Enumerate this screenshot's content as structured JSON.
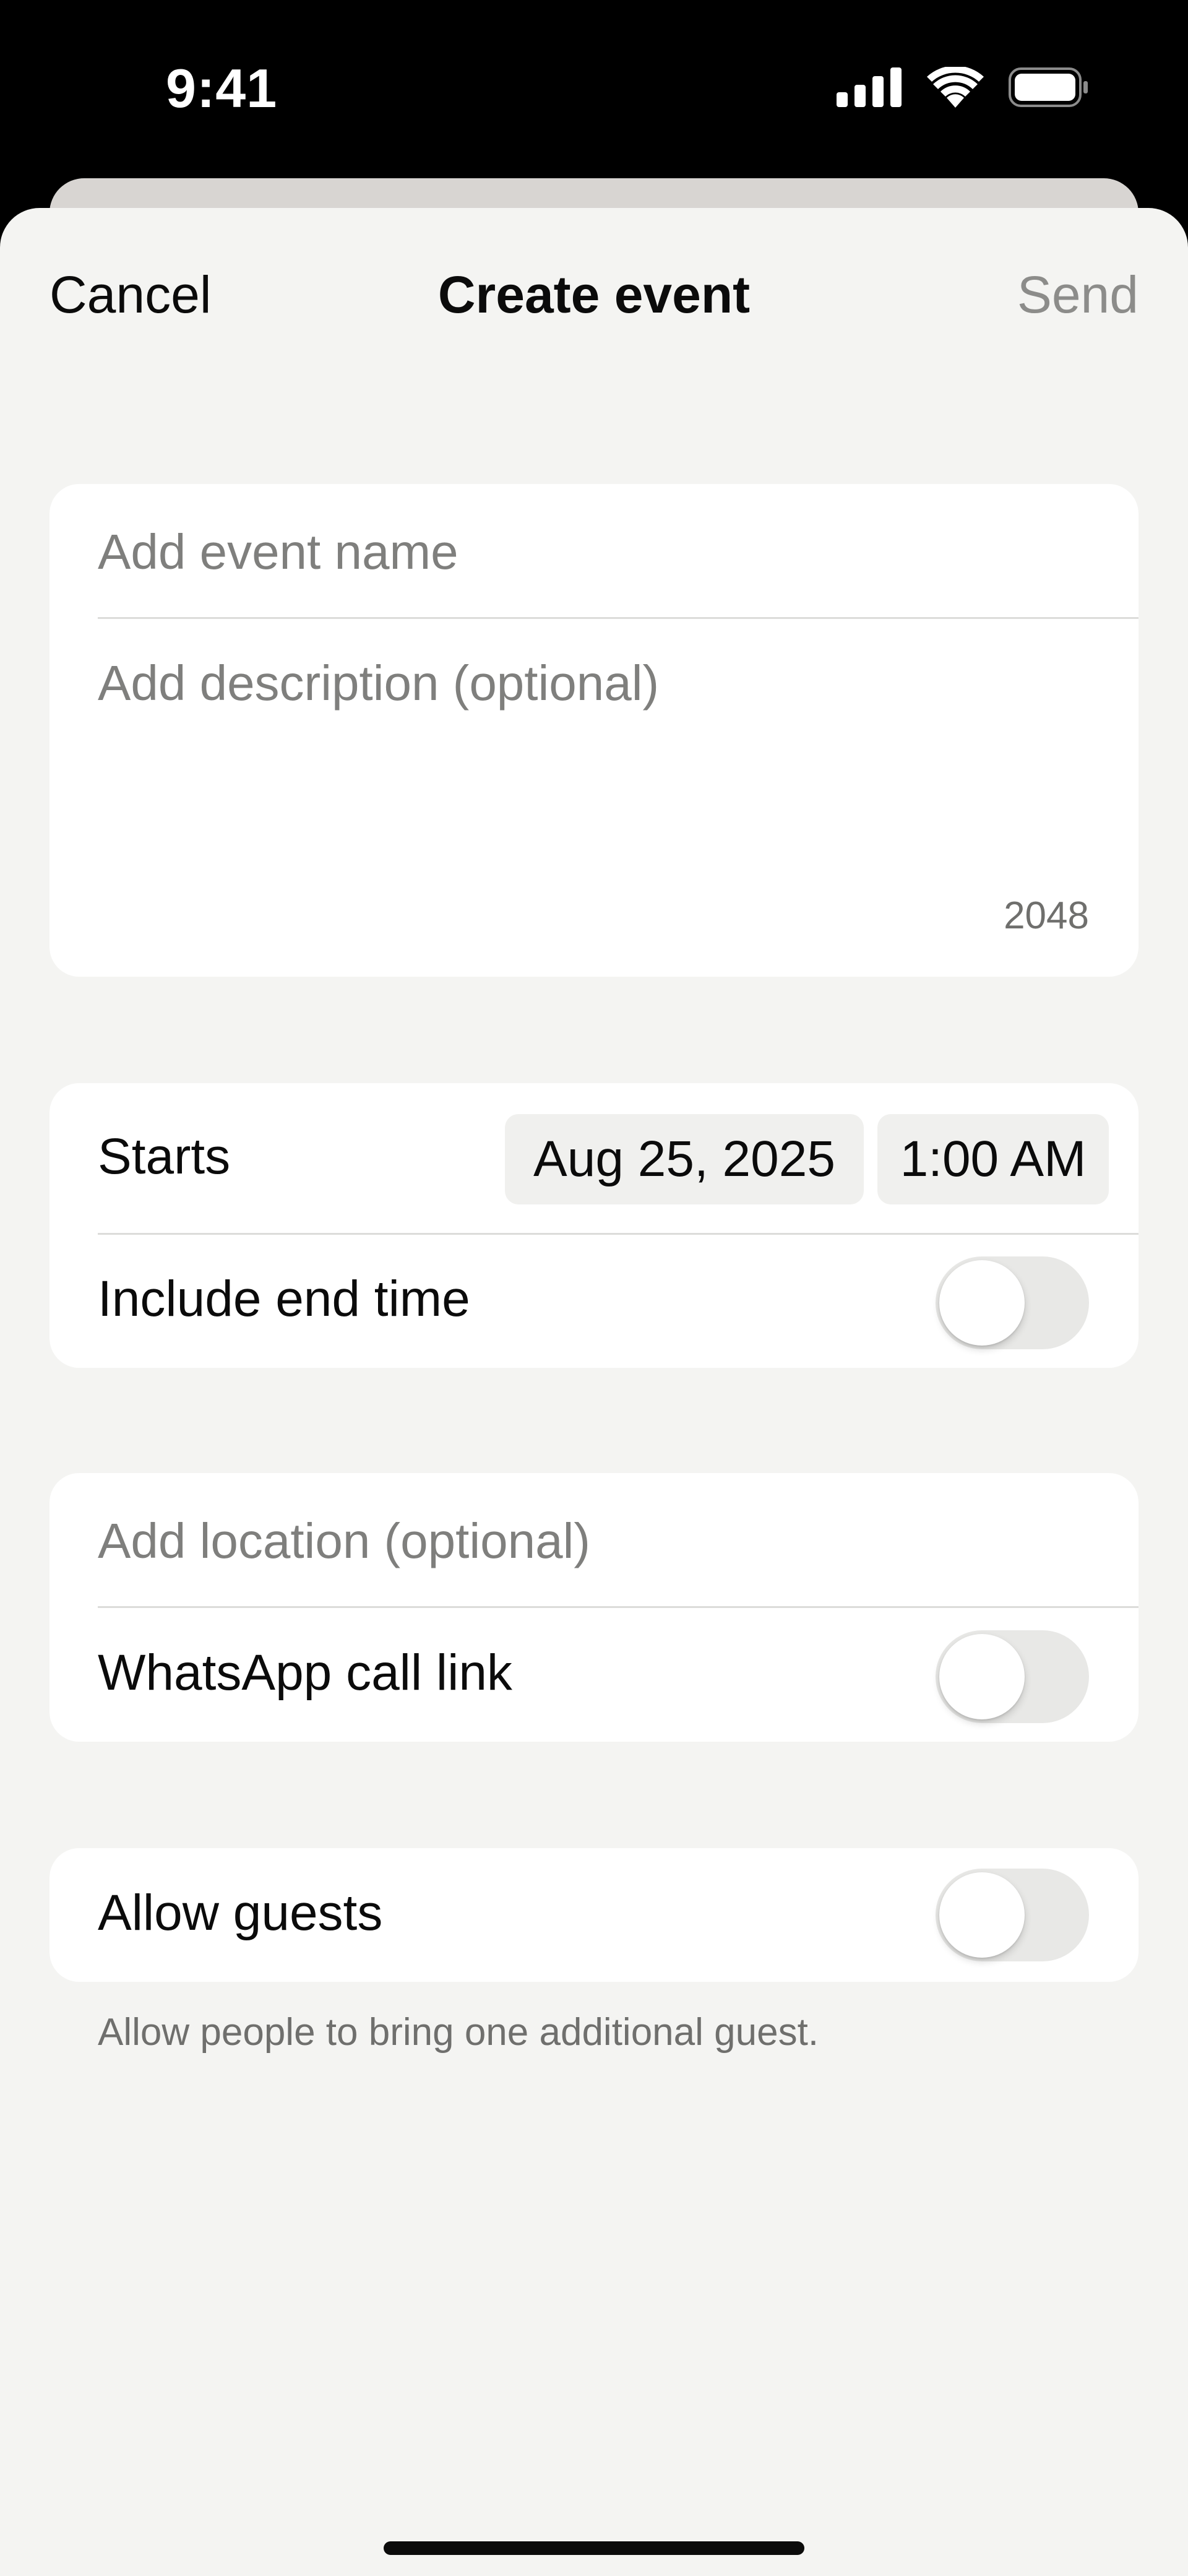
{
  "status_bar": {
    "time": "9:41",
    "icons": [
      "cellular-signal-icon",
      "wifi-icon",
      "battery-icon"
    ]
  },
  "nav": {
    "cancel_label": "Cancel",
    "title": "Create event",
    "send_label": "Send"
  },
  "details": {
    "event_name_placeholder": "Add event name",
    "description_placeholder": "Add description (optional)",
    "char_remaining": "2048"
  },
  "schedule": {
    "starts_label": "Starts",
    "date": "Aug 25, 2025",
    "time": "1:00 AM",
    "include_end_time_label": "Include end time",
    "include_end_time_on": false
  },
  "location": {
    "location_placeholder": "Add location (optional)",
    "call_link_label": "WhatsApp call link",
    "call_link_on": false
  },
  "guests": {
    "allow_guests_label": "Allow guests",
    "allow_guests_on": false,
    "helper": "Allow people to bring one additional guest."
  },
  "colors": {
    "background": "#f4f4f2",
    "card": "#ffffff",
    "text_primary": "#0b0b0b",
    "text_secondary": "#7f7f7d",
    "send_disabled": "#8c8c8a",
    "toggle_off": "#e8e8e6"
  }
}
